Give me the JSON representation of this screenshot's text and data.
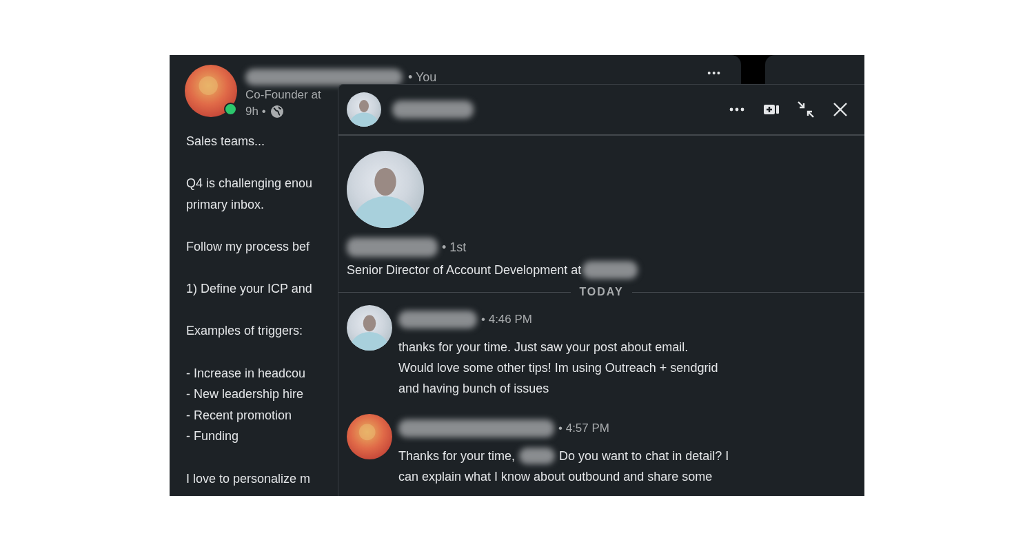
{
  "post": {
    "author": {
      "badge": "• You",
      "online": true
    },
    "headline": "Co-Founder at",
    "meta": "9h •",
    "more": "•••",
    "paragraphs": [
      [
        "Sales teams..."
      ],
      [
        "Q4 is challenging enou",
        "primary inbox."
      ],
      [
        "Follow my process bef"
      ],
      [
        "1) Define your ICP and"
      ],
      [
        "Examples of triggers:"
      ],
      [
        "- Increase in headcou",
        "- New leadership hire",
        "- Recent promotion",
        "- Funding"
      ],
      [
        "I love to personalize m"
      ]
    ]
  },
  "chat": {
    "header": {
      "actions": [
        {
          "kind": "more"
        },
        {
          "kind": "video"
        },
        {
          "kind": "minimize"
        },
        {
          "kind": "close"
        }
      ]
    },
    "profile": {
      "degree": "• 1st",
      "title": "Senior Director of Account Development at"
    },
    "divider": "TODAY",
    "messages": [
      {
        "kind": "received",
        "time": "• 4:46 PM",
        "lines": [
          [
            {
              "kind": "text",
              "text": "thanks for your time. Just saw your post about email."
            }
          ],
          [
            {
              "kind": "text",
              "text": "Would love some other tips! Im using Outreach + sendgrid"
            }
          ],
          [
            {
              "kind": "text",
              "text": "and having bunch of issues"
            }
          ]
        ]
      },
      {
        "kind": "sent",
        "time": "• 4:57 PM",
        "lines": [
          [
            {
              "kind": "text",
              "text": "Thanks for your time,"
            },
            {
              "kind": "redacted"
            },
            {
              "kind": "text",
              "text": "Do you want to chat in detail? I"
            }
          ],
          [
            {
              "kind": "text",
              "text": "can explain what I know about outbound and share some"
            }
          ]
        ]
      }
    ]
  }
}
